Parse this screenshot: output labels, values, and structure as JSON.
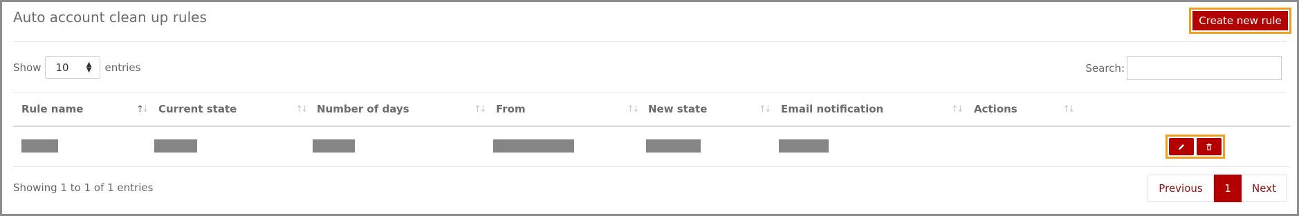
{
  "panel": {
    "title": "Auto account clean up rules",
    "create_button": "Create new rule"
  },
  "controls": {
    "show_label": "Show",
    "entries_value": "10",
    "entries_label": "entries",
    "search_label": "Search:",
    "search_value": ""
  },
  "table": {
    "columns": [
      {
        "label": "Rule name",
        "sorted": "asc"
      },
      {
        "label": "Current state"
      },
      {
        "label": "Number of days"
      },
      {
        "label": "From"
      },
      {
        "label": "New state"
      },
      {
        "label": "Email notification"
      },
      {
        "label": "Actions"
      }
    ],
    "rows": [
      {
        "cells_redacted": true,
        "actions": [
          "edit",
          "delete"
        ]
      }
    ]
  },
  "footer": {
    "info": "Showing 1 to 1 of 1 entries",
    "pagination": {
      "previous": "Previous",
      "current": "1",
      "next": "Next"
    }
  },
  "colors": {
    "accent": "#b30000",
    "highlight_outline": "#f0a020",
    "redaction": "#858585"
  },
  "icons": {
    "edit": "pencil-icon",
    "delete": "trash-icon",
    "sort": "sort-arrows-icon",
    "select": "select-arrows-icon"
  }
}
